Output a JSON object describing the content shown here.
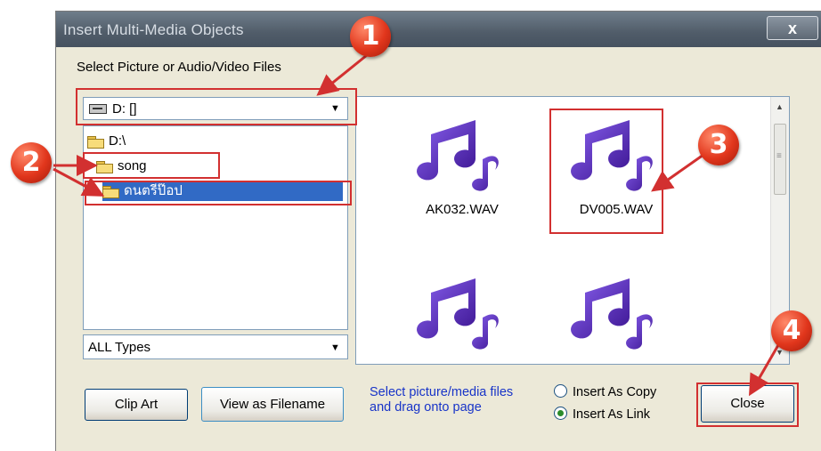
{
  "window": {
    "title": "Insert Multi-Media Objects",
    "close_glyph": "x"
  },
  "prompt_label": "Select Picture or Audio/Video Files",
  "drive_select": {
    "value": "D: []",
    "icon": "drive-icon"
  },
  "tree": {
    "nodes": [
      {
        "label": "D:\\",
        "icon": "open-folder-icon"
      },
      {
        "label": "song",
        "icon": "open-folder-icon"
      },
      {
        "label": "ดนตรีป๊อป",
        "icon": "open-folder-icon",
        "selected": true
      }
    ]
  },
  "types_select": {
    "value": "ALL Types"
  },
  "files": [
    {
      "name": "AK032.WAV",
      "icon": "music-note-icon"
    },
    {
      "name": "DV005.WAV",
      "icon": "music-note-icon"
    },
    {
      "name": "",
      "icon": "music-note-icon"
    },
    {
      "name": "",
      "icon": "music-note-icon"
    }
  ],
  "buttons": {
    "clip_art": "Clip Art",
    "view_as_filename": "View as Filename",
    "close": "Close"
  },
  "info_text": {
    "line1": "Select picture/media files",
    "line2": "and drag onto page"
  },
  "insert_mode": {
    "options": [
      "Insert As Copy",
      "Insert As Link"
    ],
    "selected": "Insert As Link"
  },
  "annotations": {
    "badges": [
      "1",
      "2",
      "3",
      "4"
    ],
    "color": "#d23030"
  }
}
